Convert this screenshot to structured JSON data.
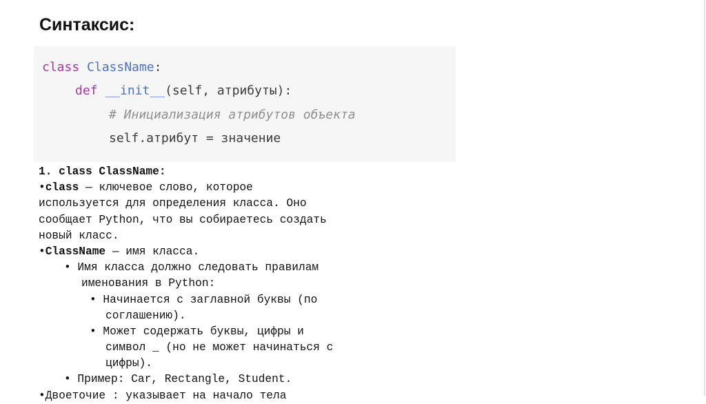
{
  "slide": {
    "title": "Синтаксис:"
  },
  "code": {
    "line1": {
      "kw": "class",
      "sp": " ",
      "name": "ClassName",
      "punct": ":"
    },
    "line2": {
      "kw": "def",
      "sp": " ",
      "fn": "__init__",
      "args": "(self, атрибуты):"
    },
    "line3": {
      "comment": "# Инициализация атрибутов объекта"
    },
    "line4": {
      "text": "self.атрибут = значение"
    }
  },
  "body": {
    "heading": "1. class ClassName:",
    "p1_bold": "class",
    "p1_rest": " — ключевое слово, которое",
    "p1_line2": "используется для определения класса. Оно",
    "p1_line3": "сообщает Python, что вы собираетесь создать",
    "p1_line4": "новый класс.",
    "p2_bold": "ClassName",
    "p2_rest": " — имя класса.",
    "sub1_line1": "• Имя класса должно следовать правилам",
    "sub1_line2": "именования в Python:",
    "subsub1_line1": "• Начинается с заглавной буквы (по",
    "subsub1_line2": "соглашению).",
    "subsub2_line1": "• Может содержать буквы, цифры и",
    "subsub2_line2": "символ _ (но не может начинаться с",
    "subsub2_line3": "цифры).",
    "sub2": "• Пример: Car, Rectangle, Student.",
    "p3_cut": "•Двоеточие : указывает на начало тела"
  }
}
